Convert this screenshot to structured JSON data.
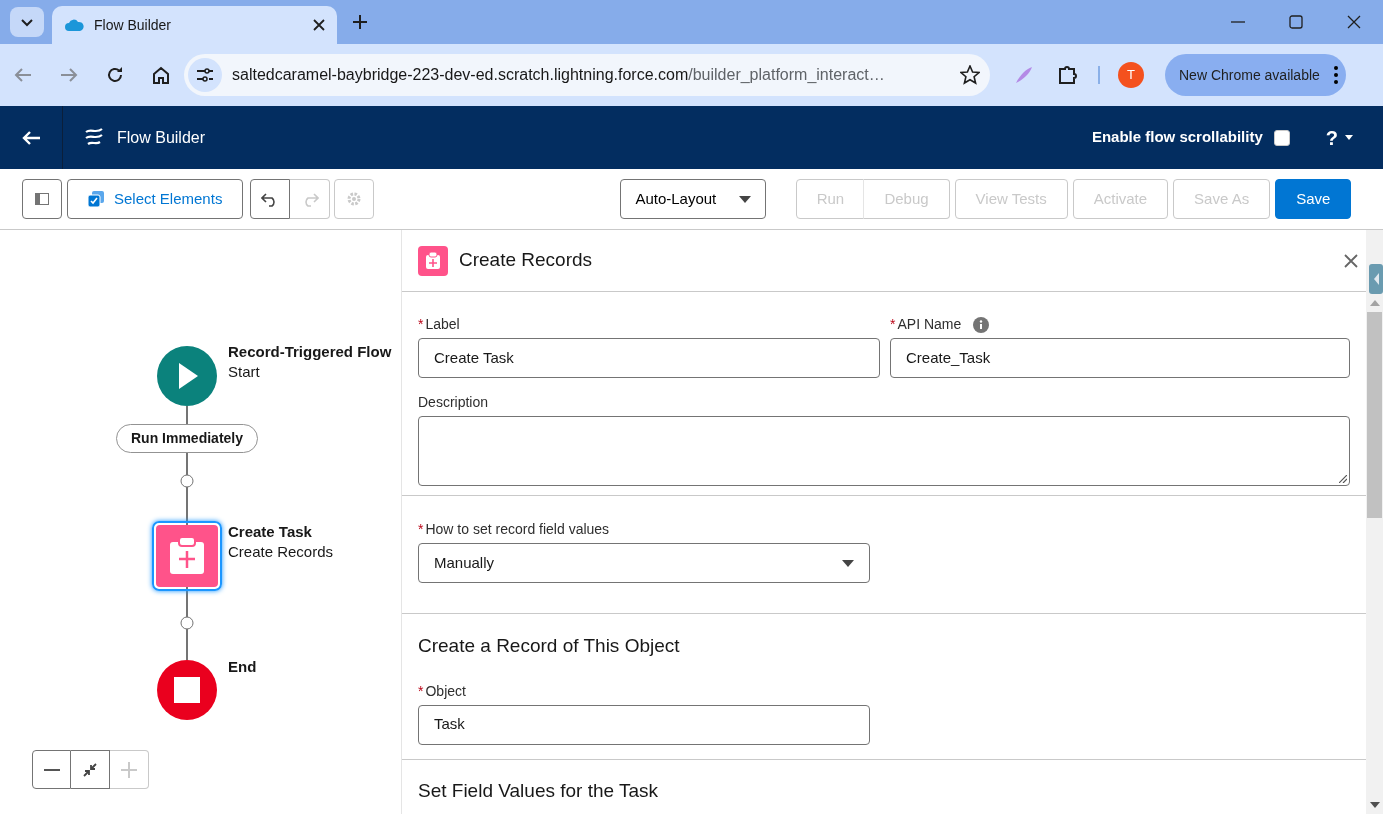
{
  "browser": {
    "tab_title": "Flow Builder",
    "url_host": "saltedcaramel-baybridge-223-dev-ed.scratch.lightning.force.com",
    "url_path": "/builder_platform_interact…",
    "avatar": "T",
    "update_label": "New Chrome available"
  },
  "app_header": {
    "title": "Flow Builder",
    "scroll_toggle": {
      "label": "Enable flow scrollability",
      "checked": false
    },
    "help": "?"
  },
  "toolbar": {
    "select_elements": "Select Elements",
    "layout": "Auto-Layout",
    "buttons": [
      {
        "label": "Run",
        "disabled": true,
        "primary": false
      },
      {
        "label": "Debug",
        "disabled": true,
        "primary": false
      },
      {
        "label": "View Tests",
        "disabled": true,
        "primary": false
      },
      {
        "label": "Activate",
        "disabled": true,
        "primary": false
      },
      {
        "label": "Save As",
        "disabled": true,
        "primary": false
      },
      {
        "label": "Save",
        "disabled": false,
        "primary": true
      }
    ]
  },
  "canvas": {
    "nodes": [
      {
        "kind": "start",
        "title": "Record-Triggered Flow",
        "subtitle": "Start"
      },
      {
        "kind": "badge",
        "title": "Run Immediately"
      },
      {
        "kind": "element",
        "title": "Create Task",
        "subtitle": "Create Records",
        "selected": true
      },
      {
        "kind": "end",
        "title": "End"
      }
    ]
  },
  "panel": {
    "title": "Create Records",
    "label_field": {
      "required_mark": "*",
      "label": "Label",
      "value": "Create Task"
    },
    "api_name_field": {
      "required_mark": "*",
      "label": "API Name",
      "value": "Create_Task"
    },
    "description_field": {
      "label": "Description"
    },
    "how_to_set": {
      "required_mark": "*",
      "label": "How to set record field values",
      "value": "Manually"
    },
    "section_object": "Create a Record of This Object",
    "object_field": {
      "required_mark": "*",
      "label": "Object",
      "value": "Task"
    },
    "section_fields": "Set Field Values for the Task"
  }
}
